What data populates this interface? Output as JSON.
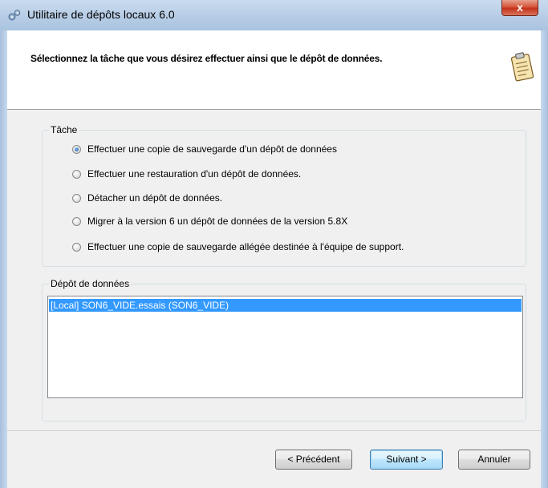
{
  "window": {
    "title": "Utilitaire de dépôts locaux 6.0",
    "close_label": "x",
    "icon": "tools-icon"
  },
  "header": {
    "title": "Sélectionnez la tâche que vous désirez effectuer ainsi que le dépôt de données.",
    "icon": "clipboard-icon"
  },
  "task_group": {
    "legend": "Tâche",
    "options": [
      {
        "label": "Effectuer une copie de sauvegarde d'un dépôt de données",
        "checked": true
      },
      {
        "label": "Effectuer une restauration d'un dépôt de données.",
        "checked": false
      },
      {
        "label": "Détacher un dépôt de données.",
        "checked": false
      },
      {
        "label": "Migrer à la version 6 un dépôt de données de la version 5.8X",
        "checked": false
      },
      {
        "label": "Effectuer une copie de sauvegarde allégée destinée à l'équipe de support.",
        "checked": false
      }
    ]
  },
  "datastore_group": {
    "legend": "Dépôt de données",
    "items": [
      {
        "label": "[Local] SON6_VIDE.essais (SON6_VIDE)",
        "selected": true
      }
    ]
  },
  "buttons": {
    "previous": "< Précédent",
    "next": "Suivant >",
    "cancel": "Annuler"
  },
  "colors": {
    "selection": "#3399ff",
    "dialog_bg": "#f0f0f0",
    "title_bar": "#b7cde6"
  }
}
